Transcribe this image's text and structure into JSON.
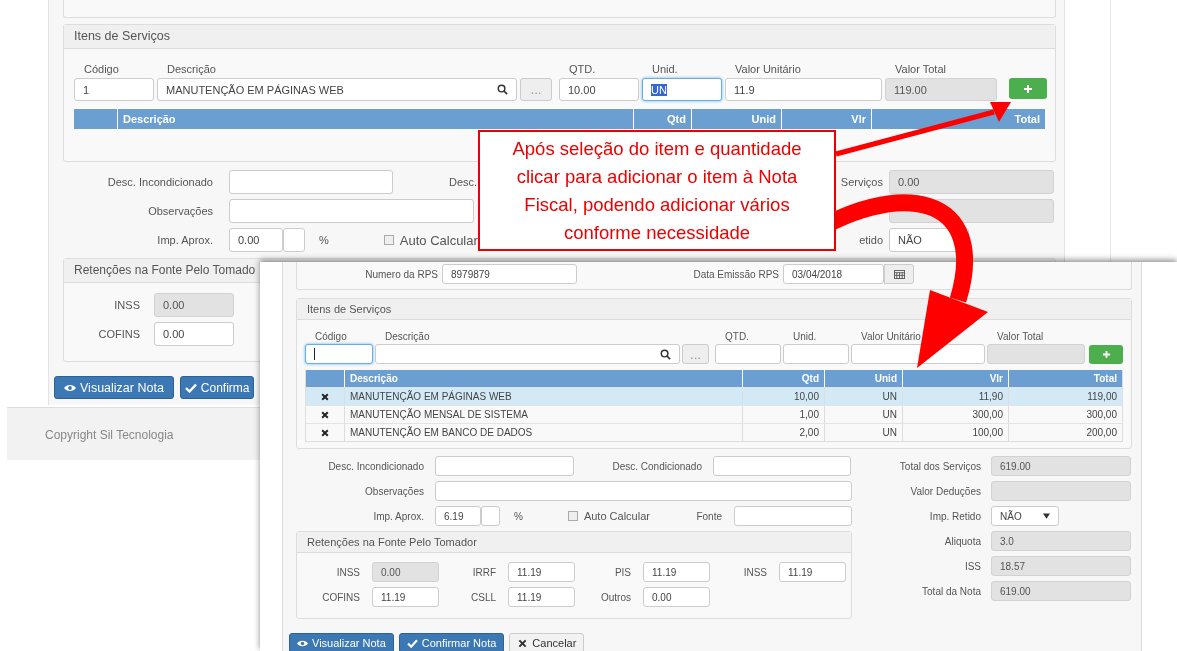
{
  "back_window": {
    "items_section": {
      "title": "Itens de Serviços",
      "fields": [
        {
          "label": "Código",
          "value": "1",
          "focused": false,
          "disabled": false
        },
        {
          "label": "Descrição",
          "value": "MANUTENÇÃO EM PÁGINAS WEB",
          "focused": false,
          "disabled": false
        },
        {
          "label": "QTD.",
          "value": "10.00",
          "focused": false,
          "disabled": false
        },
        {
          "label": "Unid.",
          "value": "UN",
          "focused": true,
          "disabled": false
        },
        {
          "label": "Valor Unitário",
          "value": "11.9",
          "focused": false,
          "disabled": false
        },
        {
          "label": "Valor Total",
          "value": "119.00",
          "focused": false,
          "disabled": true
        }
      ],
      "lookup_button": "...",
      "table": {
        "columns": [
          "Descrição",
          "Qtd",
          "Unid",
          "Vlr",
          "Total"
        ]
      }
    },
    "form": {
      "desc_incondicionado_label": "Desc. Incondicionado",
      "desc_label": "Desc.",
      "observacoes_label": "Observações",
      "imp_aprox_label": "Imp. Aprox.",
      "imp_aprox_value": "0.00",
      "percent": "%",
      "auto_calcular": {
        "label": "Auto Calcular",
        "checked": false
      },
      "servicos_label": "Serviços",
      "servicos_value": "0.00",
      "retido_label": "etido",
      "retido_value": "NÃO"
    },
    "retencoes": {
      "title": "Retenções na Fonte Pelo Tomado",
      "fields": [
        {
          "label": "INSS",
          "value": "0.00",
          "disabled": true
        },
        {
          "label": "COFINS",
          "value": "0.00",
          "disabled": false
        }
      ]
    },
    "buttons": [
      {
        "label": "Visualizar Nota",
        "kind": "view"
      },
      {
        "label": "Confirma",
        "kind": "confirm"
      }
    ],
    "footer": "Copyright Sil Tecnologia"
  },
  "callout": {
    "lines": [
      "Após seleção do item e quantidade",
      "clicar para adicionar o item à Nota",
      "Fiscal, podendo adicionar vários",
      "conforme necessidade"
    ]
  },
  "front_window": {
    "rps": {
      "numero_label": "Numero da RPS",
      "numero_value": "8979879",
      "data_label": "Data Emissão RPS",
      "data_value": "03/04/2018"
    },
    "items_section": {
      "title": "Itens de Serviços",
      "fields": [
        {
          "label": "Código",
          "focused": true,
          "disabled": false
        },
        {
          "label": "Descrição",
          "focused": false,
          "disabled": false
        },
        {
          "label": "QTD.",
          "focused": false,
          "disabled": false
        },
        {
          "label": "Unid.",
          "focused": false,
          "disabled": false
        },
        {
          "label": "Valor Unitário",
          "focused": false,
          "disabled": false
        },
        {
          "label": "Valor Total",
          "focused": false,
          "disabled": true
        }
      ],
      "lookup_button": "...",
      "table": {
        "columns": [
          "Descrição",
          "Qtd",
          "Unid",
          "Vlr",
          "Total"
        ],
        "rows": [
          {
            "cells": [
              "MANUTENÇÃO EM PÁGINAS WEB",
              "10,00",
              "UN",
              "11,90",
              "119,00"
            ],
            "selected": true
          },
          {
            "cells": [
              "MANUTENÇÃO MENSAL DE SISTEMA",
              "1,00",
              "UN",
              "300,00",
              "300,00"
            ],
            "selected": false
          },
          {
            "cells": [
              "MANUTENÇÃO EM BANCO DE DADOS",
              "2,00",
              "UN",
              "100,00",
              "200,00"
            ],
            "selected": false
          }
        ]
      }
    },
    "form": {
      "desc_incondicionado_label": "Desc. Incondicionado",
      "desc_condicionado_label": "Desc. Condicionado",
      "observacoes_label": "Observações",
      "imp_aprox_label": "Imp. Aprox.",
      "imp_aprox_value": "6.19",
      "percent": "%",
      "auto_calcular": {
        "label": "Auto Calcular",
        "checked": false
      },
      "fonte_label": "Fonte"
    },
    "retencoes": {
      "title": "Retenções na Fonte Pelo Tomador",
      "fields": [
        {
          "label": "INSS",
          "value": "0.00",
          "disabled": true
        },
        {
          "label": "IRRF",
          "value": "11.19",
          "disabled": false
        },
        {
          "label": "PIS",
          "value": "11.19",
          "disabled": false
        },
        {
          "label": "INSS",
          "value": "11.19",
          "disabled": false
        },
        {
          "label": "COFINS",
          "value": "11.19",
          "disabled": false
        },
        {
          "label": "CSLL",
          "value": "11.19",
          "disabled": false
        },
        {
          "label": "Outros",
          "value": "0.00",
          "disabled": false
        }
      ]
    },
    "summary": [
      {
        "label": "Total dos Serviços",
        "value": "619.00",
        "kind": "readonly"
      },
      {
        "label": "Valor Deduções",
        "kind": "readonly"
      },
      {
        "label": "Imp. Retido",
        "value": "NÃO",
        "kind": "select"
      },
      {
        "label": "Aliquota",
        "value": "3.0",
        "kind": "readonly"
      },
      {
        "label": "ISS",
        "value": "18.57",
        "kind": "readonly"
      },
      {
        "label": "Total da Nota",
        "value": "619.00",
        "kind": "readonly"
      }
    ],
    "buttons": [
      {
        "label": "Visualizar Nota",
        "kind": "view"
      },
      {
        "label": "Confirmar Nota",
        "kind": "confirm"
      },
      {
        "label": "Cancelar",
        "kind": "cancel"
      }
    ]
  }
}
